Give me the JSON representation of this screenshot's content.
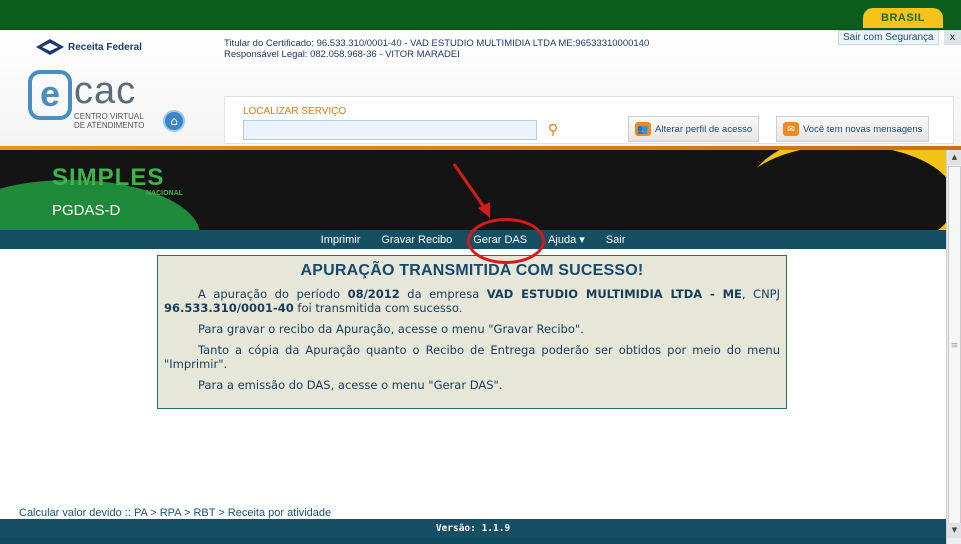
{
  "gov_bar": {
    "badge": "BRASIL"
  },
  "header": {
    "receita_federal": "Receita Federal",
    "cert_line1": "Titular do Certificado: 96.533.310/0001-40 - VAD ESTUDIO MULTIMIDIA LTDA ME:96533310000140",
    "cert_line2": "Responsável Legal: 082.058.968-36 - VITOR MARADEI",
    "logout": "Sair com Segurança",
    "close": "x",
    "ecac_e": "e",
    "ecac_cac": "cac",
    "ecac_sub1": "CENTRO VIRTUAL",
    "ecac_sub2": "DE ATENDIMENTO",
    "search_label": "LOCALIZAR SERVIÇO",
    "search_value": "",
    "btn_profile": "Alterar perfil de acesso",
    "btn_messages": "Você tem novas mensagens"
  },
  "app": {
    "logo": "SIMPLES",
    "logo_sub": "NACIONAL",
    "module": "PGDAS-D",
    "menu": [
      {
        "label": "Imprimir"
      },
      {
        "label": "Gravar Recibo"
      },
      {
        "label": "Gerar DAS"
      },
      {
        "label": "Ajuda ▾"
      },
      {
        "label": "Sair"
      }
    ]
  },
  "message": {
    "title": "APURAÇÃO TRANSMITIDA COM SUCESSO!",
    "p1_a": "A apuração do período ",
    "p1_period": "08/2012",
    "p1_b": " da empresa ",
    "p1_company": "VAD ESTUDIO MULTIMIDIA LTDA - ME",
    "p1_c": ", CNPJ ",
    "p1_cnpj": "96.533.310/0001-40",
    "p1_d": " foi transmitida com sucesso.",
    "p2": "Para gravar o recibo da Apuração, acesse o menu \"Gravar Recibo\".",
    "p3": "Tanto a cópia da Apuração quanto o Recibo de Entrega poderão ser obtidos por meio do menu \"Imprimir\".",
    "p4": "Para a emissão do DAS, acesse o menu \"Gerar DAS\"."
  },
  "breadcrumb": "Calcular valor devido :: PA > RPA > RBT > Receita por atividade",
  "footer": "Versão: 1.1.9",
  "icons": {
    "home": "home-icon",
    "search": "search-icon",
    "profile": "users-icon",
    "messages": "envelope-icon"
  },
  "colors": {
    "gov_green": "#0b5d1e",
    "accent_orange": "#e07b1a",
    "menu_bg": "#164e63",
    "title_blue": "#16496b",
    "annotation_red": "#d61a1a"
  }
}
